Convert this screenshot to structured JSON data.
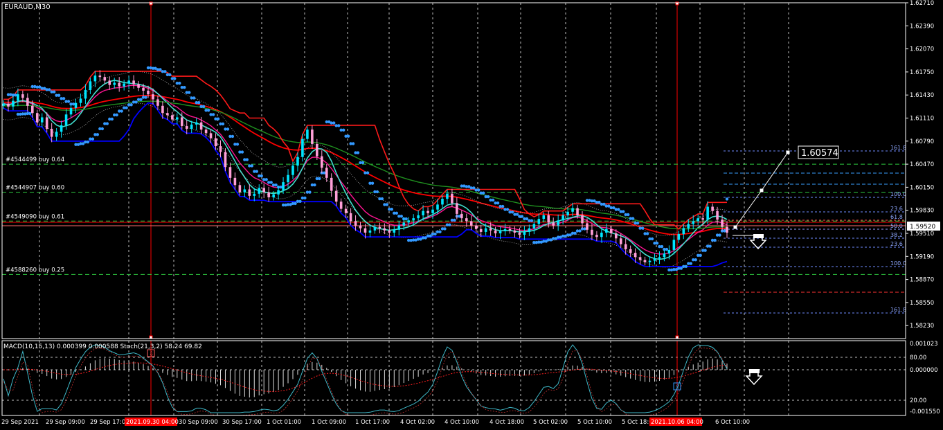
{
  "symbol_label": "EURAUD,M30",
  "indicator_label": "MACD(10,15,13) 0.000399 0.000588 Stoch(21,3,2) 58.24 69.82",
  "current_price": "1.59520",
  "target_price": "1.60574",
  "colors": {
    "background": "#000000",
    "axis": "#ffffff",
    "bull_candle": "#00e5ff",
    "bear_candle": "#ff9fd8",
    "ma_red": "#ff0000",
    "ma_magenta": "#ff1493",
    "ma_cyan": "#40e0d0",
    "ma_green": "#1f8f1f",
    "sar_dots": "#3399ff",
    "donchian": "#0000ff",
    "vline": "#ff0000",
    "grid": "#ffffff"
  },
  "price_axis": [
    "1.62710",
    "1.62390",
    "1.62070",
    "1.61750",
    "1.61430",
    "1.61110",
    "1.60790",
    "1.60470",
    "1.60150",
    "1.59830",
    "1.59510",
    "1.59190",
    "1.58870",
    "1.58550",
    "1.58230"
  ],
  "macd_axis": [
    "0.001023",
    "80.00",
    "0.000000",
    "20.00",
    "-0.001550"
  ],
  "time_axis": [
    "29 Sep 2021",
    "29 Sep 09:00",
    "29 Sep 17:00",
    "30 Sep 01:00",
    "30 Sep 09:00",
    "30 Sep 17:00",
    "1 Oct 01:00",
    "1 Oct 09:00",
    "1 Oct 17:00",
    "4 Oct 02:00",
    "4 Oct 10:00",
    "4 Oct 18:00",
    "5 Oct 02:00",
    "5 Oct 10:00",
    "5 Oct 18:00",
    "6 Oct 02:00",
    "6 Oct 10:00"
  ],
  "time_highlight": [
    "2021.09.30 04:00",
    "2021.10.06 04:00"
  ],
  "order_lines": [
    {
      "label": "#4544499 buy 0.64",
      "price": 1.6047
    },
    {
      "label": "#4544907 buy 0.60",
      "price": 1.6008
    },
    {
      "label": "#4549090 buy 0.61",
      "price": 1.5968
    },
    {
      "label": "#4588260 buy 0.25",
      "price": 1.5894
    }
  ],
  "fib_labels": [
    "161.8",
    "100.0",
    "23.6",
    "61.8",
    "50.0",
    "38.2",
    "23.6",
    "100.0",
    "161.8"
  ],
  "trend_arrows": [
    "up",
    "down"
  ],
  "close_series": [
    1.6131,
    1.6127,
    1.6135,
    1.6144,
    1.6139,
    1.6128,
    1.6118,
    1.6105,
    1.6112,
    1.6096,
    1.6085,
    1.6092,
    1.6101,
    1.6116,
    1.6125,
    1.6132,
    1.6138,
    1.615,
    1.6162,
    1.617,
    1.6168,
    1.6163,
    1.6157,
    1.616,
    1.6155,
    1.6159,
    1.6163,
    1.6158,
    1.6153,
    1.6149,
    1.6144,
    1.6137,
    1.6128,
    1.6118,
    1.6115,
    1.6109,
    1.6112,
    1.61,
    1.6096,
    1.6102,
    1.6105,
    1.6095,
    1.609,
    1.6083,
    1.6072,
    1.6064,
    1.6043,
    1.6028,
    1.6018,
    1.6008,
    1.6012,
    1.6003,
    1.6006,
    1.6014,
    1.6008,
    1.6001,
    1.6005,
    1.6011,
    1.6022,
    1.6032,
    1.6045,
    1.6057,
    1.6082,
    1.6095,
    1.6075,
    1.6058,
    1.6042,
    1.6028,
    1.601,
    1.5995,
    1.5985,
    1.5979,
    1.5968,
    1.5962,
    1.5958,
    1.5952,
    1.5955,
    1.596,
    1.5958,
    1.5955,
    1.5952,
    1.5956,
    1.5962,
    1.5966,
    1.5969,
    1.5972,
    1.5976,
    1.5982,
    1.5979,
    1.5984,
    1.5991,
    1.5999,
    1.6006,
    1.5993,
    1.5978,
    1.5972,
    1.5968,
    1.5962,
    1.5957,
    1.5953,
    1.5958,
    1.5955,
    1.5951,
    1.5954,
    1.5957,
    1.5955,
    1.5952,
    1.5949,
    1.5953,
    1.5958,
    1.5964,
    1.5971,
    1.5976,
    1.5966,
    1.5962,
    1.5969,
    1.5976,
    1.5981,
    1.5986,
    1.5976,
    1.5965,
    1.5956,
    1.5949,
    1.5946,
    1.5952,
    1.5957,
    1.5951,
    1.5944,
    1.5936,
    1.5929,
    1.5924,
    1.5918,
    1.5914,
    1.5911,
    1.5913,
    1.5916,
    1.5918,
    1.5923,
    1.5928,
    1.5942,
    1.595,
    1.5958,
    1.5964,
    1.5968,
    1.5972,
    1.597,
    1.5988,
    1.5982,
    1.597,
    1.596,
    1.5952
  ]
}
